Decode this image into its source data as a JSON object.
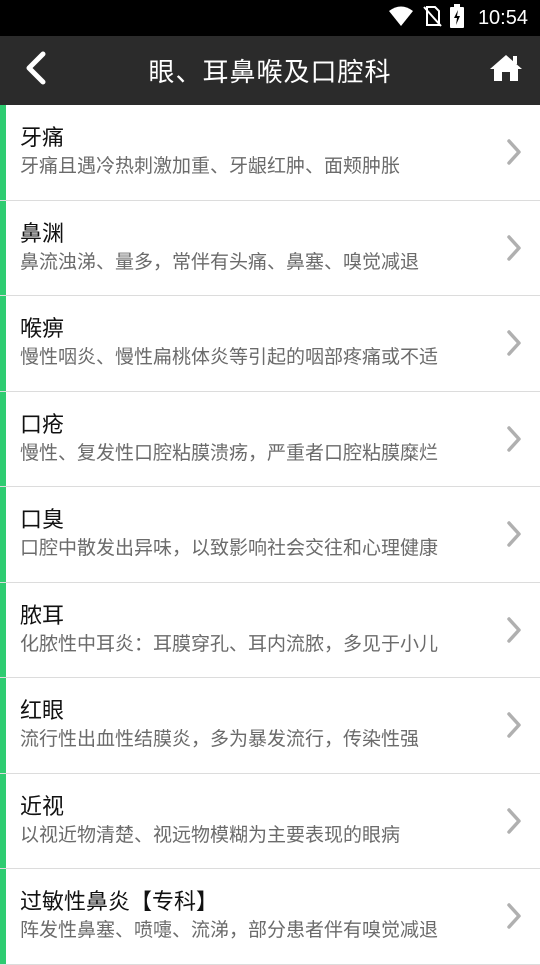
{
  "status_bar": {
    "time": "10:54",
    "icons": [
      "wifi-icon",
      "no-sim-icon",
      "battery-charging-icon"
    ]
  },
  "app_bar": {
    "title": "眼、耳鼻喉及口腔科",
    "back_icon": "chevron-left-icon",
    "home_icon": "home-icon"
  },
  "colors": {
    "status_bar_bg": "#000000",
    "app_bar_bg": "#2b2b2b",
    "accent": "#2ecc71",
    "divider": "#dcdcdc",
    "title_text": "#111111",
    "desc_text": "#6b6b6b",
    "chevron": "#b0b0b0"
  },
  "list": {
    "items": [
      {
        "title": "牙痛",
        "desc": "牙痛且遇冷热刺激加重、牙龈红肿、面颊肿胀"
      },
      {
        "title": "鼻渊",
        "desc": "鼻流浊涕、量多，常伴有头痛、鼻塞、嗅觉减退"
      },
      {
        "title": "喉痹",
        "desc": "慢性咽炎、慢性扁桃体炎等引起的咽部疼痛或不适"
      },
      {
        "title": "口疮",
        "desc": "慢性、复发性口腔粘膜溃疡，严重者口腔粘膜糜烂"
      },
      {
        "title": "口臭",
        "desc": "口腔中散发出异味，以致影响社会交往和心理健康"
      },
      {
        "title": "脓耳",
        "desc": "化脓性中耳炎：耳膜穿孔、耳内流脓，多见于小儿"
      },
      {
        "title": "红眼",
        "desc": "流行性出血性结膜炎，多为暴发流行，传染性强"
      },
      {
        "title": "近视",
        "desc": "以视近物清楚、视远物模糊为主要表现的眼病"
      },
      {
        "title": "过敏性鼻炎【专科】",
        "desc": "阵发性鼻塞、喷嚏、流涕，部分患者伴有嗅觉减退"
      }
    ]
  }
}
